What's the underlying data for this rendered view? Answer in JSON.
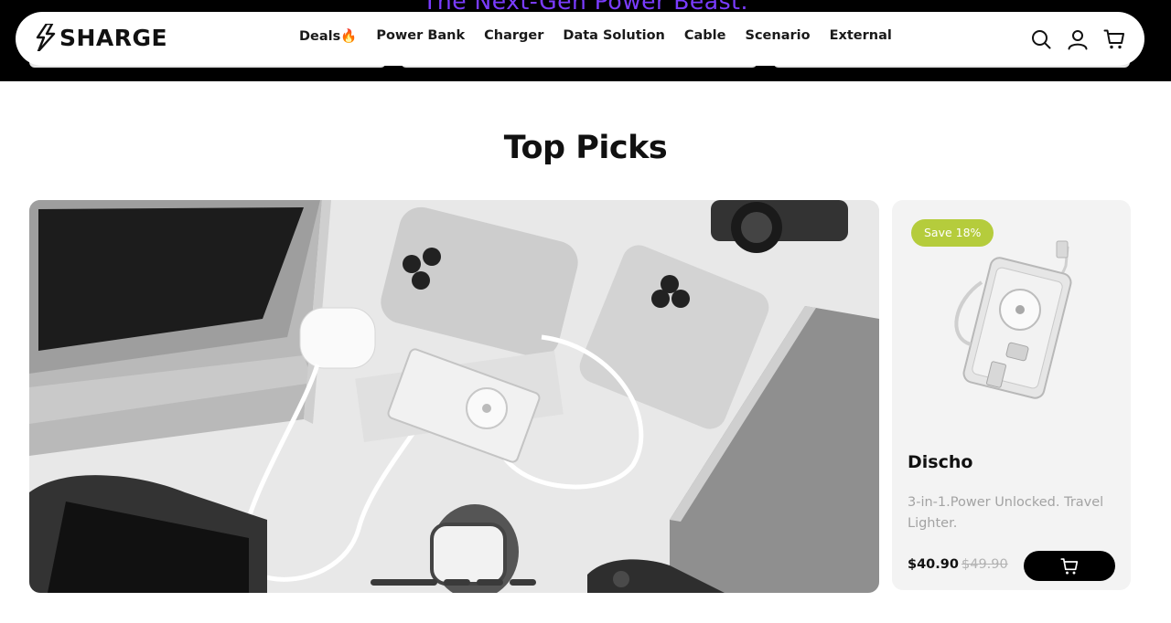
{
  "hero": {
    "headline": "The Next-Gen Power Beast.",
    "headline_color": "#7a3cff",
    "background_color": "#000000"
  },
  "header": {
    "logo_text": "SHARGE",
    "nav": [
      {
        "label": "Deals🔥"
      },
      {
        "label": "Power Bank"
      },
      {
        "label": "Charger"
      },
      {
        "label": "Data Solution"
      },
      {
        "label": "Cable"
      },
      {
        "label": "Scenario"
      },
      {
        "label": "External"
      }
    ],
    "icons": [
      "search-icon",
      "account-icon",
      "cart-icon"
    ]
  },
  "section": {
    "title": "Top Picks"
  },
  "carousel": {
    "slide_count": 4,
    "active_slide": 1
  },
  "product": {
    "badge": "Save 18%",
    "badge_color": "#b5cc3c",
    "name": "Discho",
    "description": "3-in-1.Power Unlocked. Travel Lighter.",
    "price": "$40.90",
    "compare_price": "$49.90",
    "cart_icon": "cart-icon"
  }
}
